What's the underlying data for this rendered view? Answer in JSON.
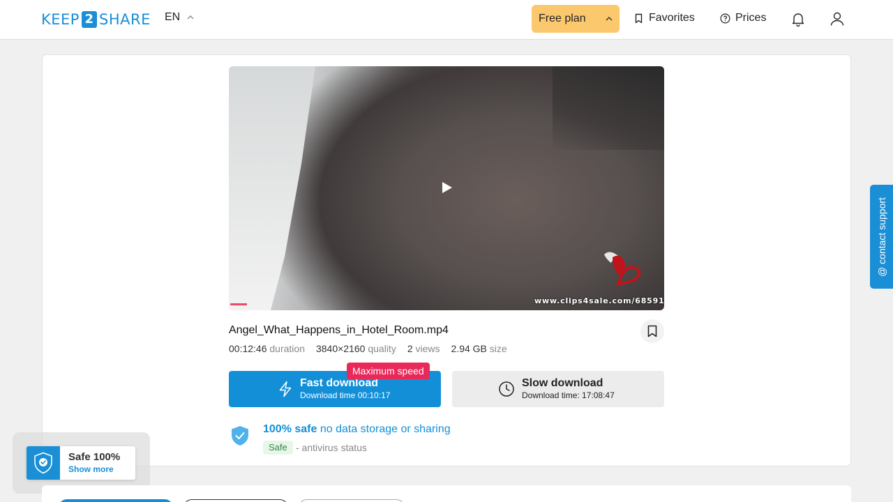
{
  "header": {
    "logo_left": "KEEP",
    "logo_mid": "2",
    "logo_right": "SHARE",
    "language": "EN",
    "plan_label": "Free plan",
    "favorites_label": "Favorites",
    "prices_label": "Prices"
  },
  "video": {
    "watermark_url": "www.clips4sale.com/68591"
  },
  "file": {
    "name": "Angel_What_Happens_in_Hotel_Room.mp4",
    "duration_value": "00:12:46",
    "duration_label": "duration",
    "quality_value": "3840×2160",
    "quality_label": "quality",
    "views_value": "2",
    "views_label": "views",
    "size_value": "2.94 GB",
    "size_label": "size"
  },
  "download": {
    "badge": "Maximum speed",
    "fast_label": "Fast download",
    "fast_time": "Download time 00:10:17",
    "slow_label": "Slow download",
    "slow_time": "Download time: 17:08:47"
  },
  "safety": {
    "bold": "100% safe",
    "text": "no data storage or sharing",
    "tag": "Safe",
    "status": "- antivirus status"
  },
  "contact_support": "@ contact support",
  "safe_widget": {
    "title": "Safe 100%",
    "link": "Show more"
  },
  "colors": {
    "brand": "#138fd8",
    "plan": "#fbc86d",
    "badge": "#e8295a"
  }
}
